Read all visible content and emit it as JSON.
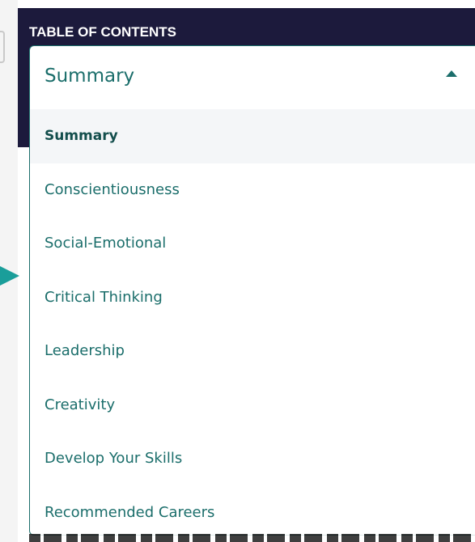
{
  "toc": {
    "title": "TABLE OF CONTENTS",
    "selected": "Summary",
    "caret_icon": "chevron-up-icon",
    "options": [
      {
        "label": "Summary",
        "active": true
      },
      {
        "label": "Conscientiousness",
        "active": false
      },
      {
        "label": "Social-Emotional",
        "active": false
      },
      {
        "label": "Critical Thinking",
        "active": false
      },
      {
        "label": "Leadership",
        "active": false
      },
      {
        "label": "Creativity",
        "active": false
      },
      {
        "label": "Develop Your Skills",
        "active": false
      },
      {
        "label": "Recommended Careers",
        "active": false
      }
    ]
  },
  "colors": {
    "header_bg": "#1c1a3c",
    "accent": "#1b6e6b",
    "arrow": "#1a9e9a",
    "active_row_bg": "#f4f6f8"
  }
}
